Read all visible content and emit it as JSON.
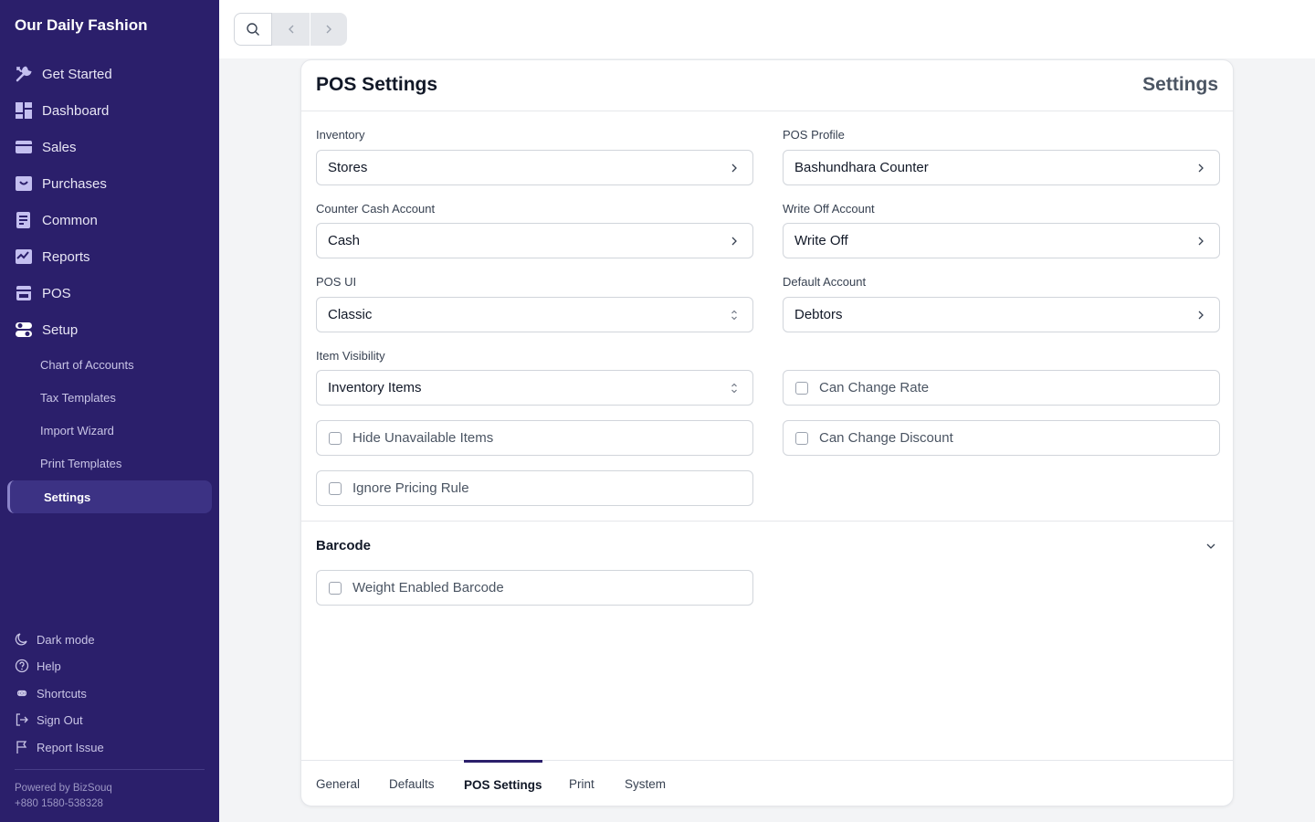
{
  "app": {
    "brand": "Our Daily Fashion"
  },
  "sidebar": {
    "items": [
      {
        "label": "Get Started",
        "icon": "tools-icon"
      },
      {
        "label": "Dashboard",
        "icon": "dashboard-icon"
      },
      {
        "label": "Sales",
        "icon": "sales-icon"
      },
      {
        "label": "Purchases",
        "icon": "purchases-icon"
      },
      {
        "label": "Common",
        "icon": "common-icon"
      },
      {
        "label": "Reports",
        "icon": "reports-icon"
      },
      {
        "label": "POS",
        "icon": "pos-icon"
      },
      {
        "label": "Setup",
        "icon": "setup-icon"
      }
    ],
    "setup_children": [
      "Chart of Accounts",
      "Tax Templates",
      "Import Wizard",
      "Print Templates",
      "Settings"
    ],
    "footer": [
      {
        "label": "Dark mode",
        "icon": "moon-icon"
      },
      {
        "label": "Help",
        "icon": "help-icon"
      },
      {
        "label": "Shortcuts",
        "icon": "command-icon"
      },
      {
        "label": "Sign Out",
        "icon": "sign-out-icon"
      },
      {
        "label": "Report Issue",
        "icon": "flag-icon"
      }
    ],
    "powered_by": "Powered by BizSouq",
    "phone": "+880 1580-538328"
  },
  "page": {
    "title": "POS Settings",
    "section": "Settings",
    "fields": {
      "inventory": {
        "label": "Inventory",
        "value": "Stores"
      },
      "pos_profile": {
        "label": "POS Profile",
        "value": "Bashundhara Counter"
      },
      "counter_cash_account": {
        "label": "Counter Cash Account",
        "value": "Cash"
      },
      "write_off_account": {
        "label": "Write Off Account",
        "value": "Write Off"
      },
      "pos_ui": {
        "label": "POS UI",
        "value": "Classic"
      },
      "default_account": {
        "label": "Default Account",
        "value": "Debtors"
      },
      "item_visibility": {
        "label": "Item Visibility",
        "value": "Inventory Items"
      }
    },
    "checkboxes": {
      "can_change_rate": "Can Change Rate",
      "hide_unavailable_items": "Hide Unavailable Items",
      "can_change_discount": "Can Change Discount",
      "ignore_pricing_rule": "Ignore Pricing Rule",
      "weight_enabled_barcode": "Weight Enabled Barcode"
    },
    "barcode_section": "Barcode",
    "tabs": [
      "General",
      "Defaults",
      "POS Settings",
      "Print",
      "System"
    ],
    "active_tab": "POS Settings"
  },
  "colors": {
    "sidebar_bg": "#2b1f6b",
    "sidebar_active": "#3c3284",
    "page_bg": "#f3f4f6"
  }
}
